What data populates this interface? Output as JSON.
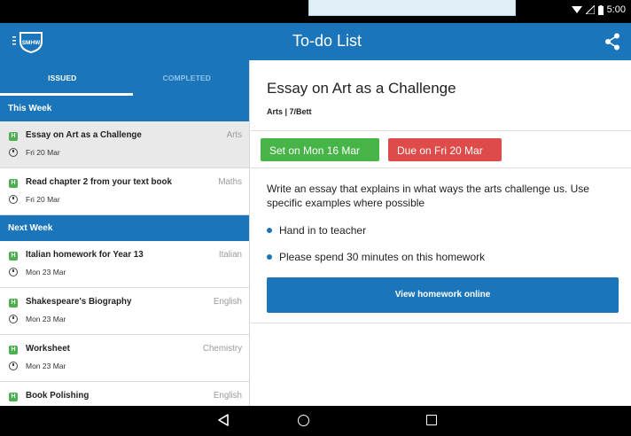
{
  "status_bar": {
    "time": "5:00"
  },
  "app_bar": {
    "title": "To-do List",
    "logo_text": "SMHW",
    "menu_icon": "menu-icon",
    "share_icon": "share-icon"
  },
  "tabs": [
    {
      "label": "ISSUED",
      "active": true
    },
    {
      "label": "COMPLETED",
      "active": false
    }
  ],
  "sections": [
    {
      "header": "This Week",
      "items": [
        {
          "badge": "H",
          "title": "Essay on Art as a Challenge",
          "subject": "Arts",
          "date": "Fri 20 Mar",
          "selected": true
        },
        {
          "badge": "H",
          "title": "Read chapter 2 from your text book",
          "subject": "Maths",
          "date": "Fri 20 Mar",
          "selected": false
        }
      ]
    },
    {
      "header": "Next Week",
      "items": [
        {
          "badge": "H",
          "title": "Italian homework for Year 13",
          "subject": "Italian",
          "date": "Mon 23 Mar",
          "selected": false
        },
        {
          "badge": "H",
          "title": "Shakespeare's Biography",
          "subject": "English",
          "date": "Mon 23 Mar",
          "selected": false
        },
        {
          "badge": "H",
          "title": "Worksheet",
          "subject": "Chemistry",
          "date": "Mon 23 Mar",
          "selected": false
        },
        {
          "badge": "H",
          "title": "Book Polishing",
          "subject": "English",
          "date": "",
          "selected": false
        }
      ]
    }
  ],
  "detail": {
    "title": "Essay on Art as a Challenge",
    "subtitle": "Arts | 7/Bett",
    "set_label": "Set on Mon 16 Mar",
    "due_label": "Due on Fri 20 Mar",
    "description": "Write an essay that explains in what ways the arts challenge us. Use specific examples where possible",
    "bullets": [
      "Hand in to teacher",
      "Please spend 30 minutes on this homework"
    ],
    "button_label": "View homework online"
  },
  "colors": {
    "brand": "#1b75bb",
    "set_green": "#46b446",
    "due_red": "#dd4b4b",
    "homework_badge": "#4caf50"
  }
}
